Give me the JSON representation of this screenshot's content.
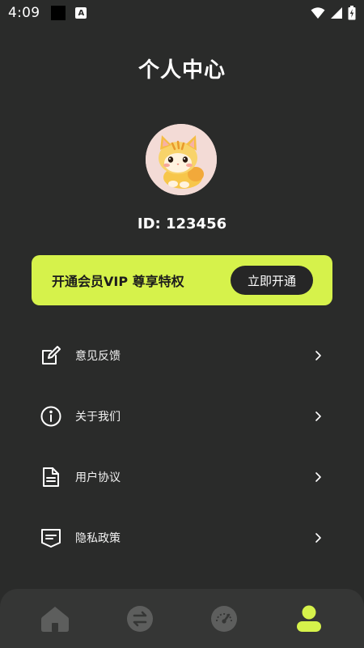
{
  "status_bar": {
    "time": "4:09",
    "notification_letter": "A"
  },
  "page": {
    "title": "个人中心"
  },
  "profile": {
    "user_id": "ID: 123456",
    "avatar_icon": "cat-avatar"
  },
  "vip": {
    "text": "开通会员VIP 尊享特权",
    "button_label": "立即开通",
    "accent_color": "#d6f24b"
  },
  "menu": {
    "items": [
      {
        "label": "意见反馈",
        "icon": "edit-icon"
      },
      {
        "label": "关于我们",
        "icon": "info-icon"
      },
      {
        "label": "用户协议",
        "icon": "document-icon"
      },
      {
        "label": "隐私政策",
        "icon": "policy-icon"
      }
    ]
  },
  "bottom_nav": {
    "items": [
      {
        "name": "home",
        "icon": "home-icon",
        "active": false
      },
      {
        "name": "convert",
        "icon": "swap-icon",
        "active": false
      },
      {
        "name": "speed",
        "icon": "speedometer-icon",
        "active": false
      },
      {
        "name": "profile",
        "icon": "user-icon",
        "active": true
      }
    ]
  }
}
